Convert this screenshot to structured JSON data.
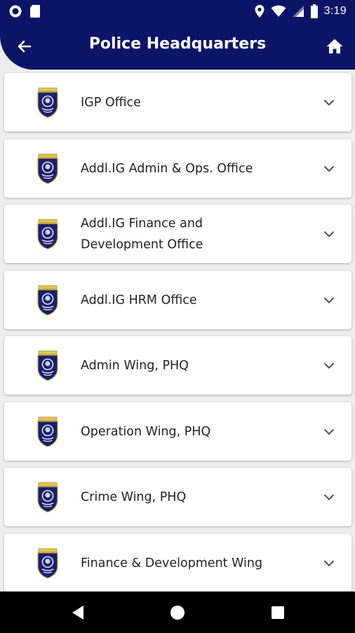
{
  "status_bar": {
    "time": "3:19",
    "left_icons": [
      "notification-circle-icon",
      "sd-card-icon"
    ],
    "right_icons": [
      "location-icon",
      "wifi-icon",
      "cell-signal-icon",
      "battery-icon"
    ]
  },
  "header": {
    "title": "Police Headquarters",
    "back_icon": "arrow-left-icon",
    "home_icon": "home-icon",
    "color": "#0c1565"
  },
  "offices": [
    {
      "label": "IGP Office"
    },
    {
      "label": "Addl.IG Admin & Ops. Office"
    },
    {
      "label": "Addl.IG Finance and Development Office"
    },
    {
      "label": "Addl.IG HRM Office"
    },
    {
      "label": "Admin Wing, PHQ"
    },
    {
      "label": "Operation Wing, PHQ"
    },
    {
      "label": "Crime Wing, PHQ"
    },
    {
      "label": "Finance & Development Wing"
    }
  ],
  "nav_bar": {
    "buttons": [
      "back-triangle-icon",
      "home-circle-icon",
      "recents-square-icon"
    ]
  }
}
